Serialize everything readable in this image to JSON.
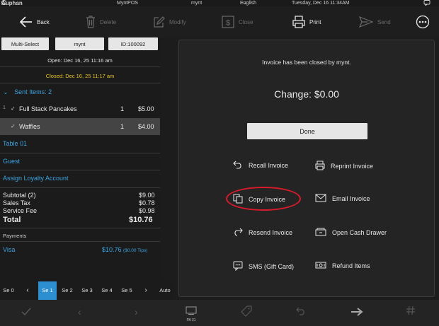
{
  "status_bar": {
    "brand": "Auphan",
    "app": "MyntPOS",
    "user": "mynt",
    "language": "English",
    "datetime": "Tuesday, Dec 16 11:34AM"
  },
  "toolbar": {
    "back": "Back",
    "delete": "Delete",
    "modify": "Modify",
    "close": "Close",
    "print": "Print",
    "send": "Send"
  },
  "order": {
    "multi_select": "Multi-Select",
    "server": "mynt",
    "id": "ID:100092",
    "opened": "Open: Dec 16, 25 11:16 am",
    "closed": "Closed: Dec 16, 25 11:17 am",
    "sent_items": "Sent Items: 2",
    "items": [
      {
        "seat": "1",
        "check": "✓",
        "name": "Full Stack Pancakes",
        "qty": "1",
        "price": "$5.00"
      },
      {
        "seat": "",
        "check": "✓",
        "name": "Waffles",
        "qty": "1",
        "price": "$4.00"
      }
    ],
    "table": "Table 01",
    "guest": "Guest",
    "loyalty": "Assign Loyalty Account",
    "totals": [
      {
        "label": "Subtotal (2)",
        "value": "$9.00"
      },
      {
        "label": "Sales Tax",
        "value": "$0.78"
      },
      {
        "label": "Service Fee",
        "value": "$0.98"
      }
    ],
    "total_label": "Total",
    "total_value": "$10.76",
    "payments_label": "Payments",
    "payment_method": "Visa",
    "payment_amount": "$10.76",
    "payment_tips": "($0.00 Tips)"
  },
  "seats": {
    "items": [
      "Se 0",
      "Se 1",
      "Se 2",
      "Se 3",
      "Se 4",
      "Se 5"
    ],
    "selected": "Se 1",
    "auto": "Auto"
  },
  "dialog": {
    "message": "Invoice has been closed by mynt.",
    "change": "Change: $0.00",
    "done": "Done",
    "actions": [
      {
        "label": "Recall Invoice",
        "icon": "undo-icon"
      },
      {
        "label": "Reprint Invoice",
        "icon": "printer-icon"
      },
      {
        "label": "Copy Invoice",
        "icon": "copy-icon"
      },
      {
        "label": "Email Invoice",
        "icon": "mail-icon"
      },
      {
        "label": "Resend Invoice",
        "icon": "redo-icon"
      },
      {
        "label": "Open Cash Drawer",
        "icon": "cash-drawer-icon"
      },
      {
        "label": "SMS (Gift Card)",
        "icon": "sms-icon"
      },
      {
        "label": "Refund Items",
        "icon": "refund-icon"
      }
    ],
    "highlight_color": "#d81b2a"
  },
  "bottom_bar": {
    "pa_label": "PA 31"
  }
}
